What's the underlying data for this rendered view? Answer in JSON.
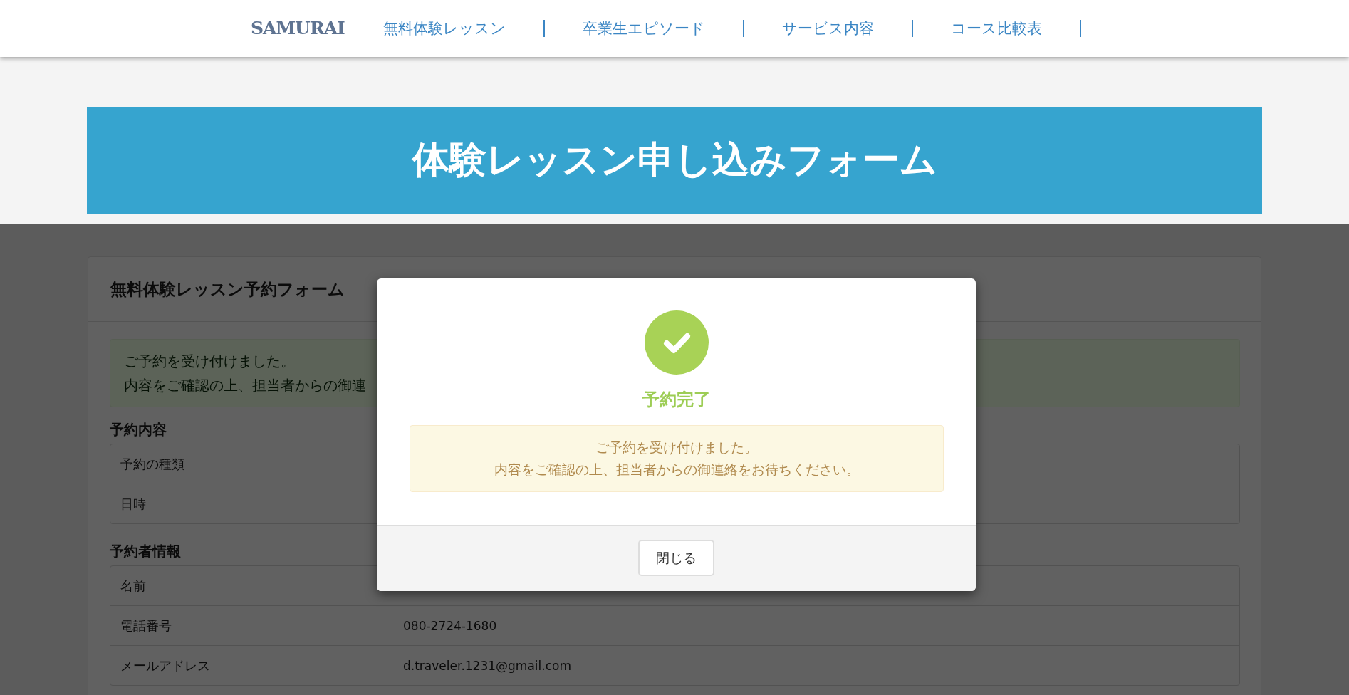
{
  "header": {
    "logo": "SAMURAI",
    "nav": [
      {
        "label": "無料体験レッスン"
      },
      {
        "label": "卒業生エピソード"
      },
      {
        "label": "サービス内容"
      },
      {
        "label": "コース比較表"
      }
    ]
  },
  "banner": {
    "title": "体験レッスン申し込みフォーム"
  },
  "form": {
    "title": "無料体験レッスン予約フォーム",
    "alert": {
      "lines": [
        "ご予約を受け付けました。",
        "内容をご確認の上、担当者からの御連"
      ]
    },
    "sections": [
      {
        "heading": "予約内容",
        "rows": [
          {
            "label": "予約の種類"
          },
          {
            "label": "日時"
          }
        ]
      },
      {
        "heading": "予約者情報",
        "rows": [
          {
            "label": "名前"
          },
          {
            "label": "電話番号",
            "value": "080-2724-1680"
          },
          {
            "label": "メールアドレス",
            "value": "d.traveler.1231@gmail.com"
          }
        ]
      }
    ]
  },
  "modal": {
    "title": "予約完了",
    "message": [
      "ご予約を受け付けました。",
      "内容をご確認の上、担当者からの御連絡をお待ちください。"
    ],
    "close_button": "閉じる"
  }
}
